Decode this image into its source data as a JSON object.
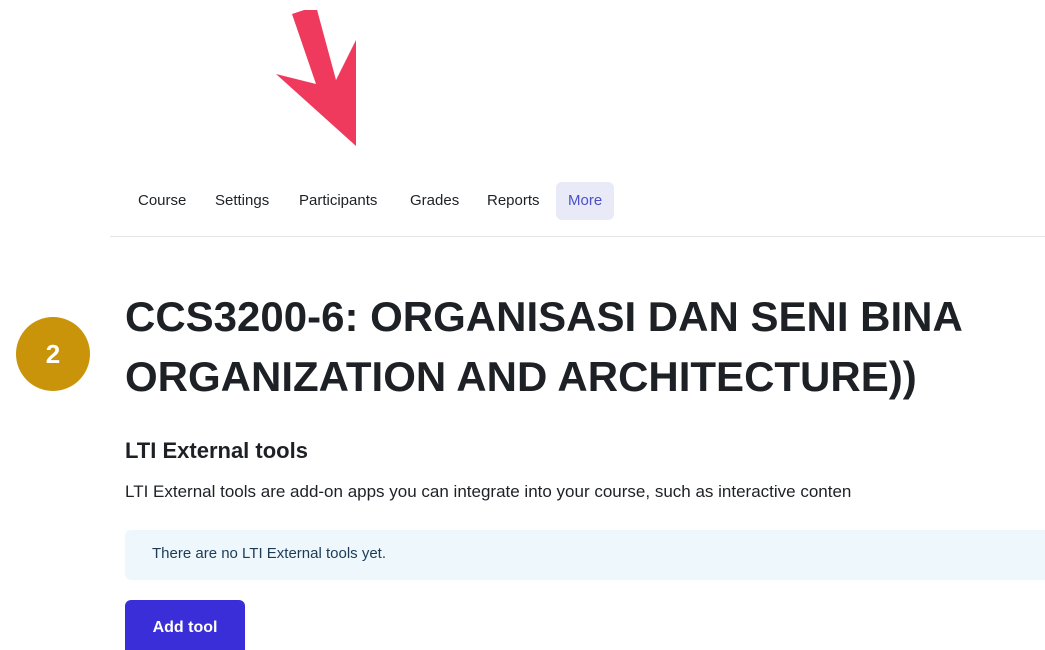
{
  "secondary_nav": {
    "items": [
      {
        "label": "Course"
      },
      {
        "label": "Settings"
      },
      {
        "label": "Participants"
      },
      {
        "label": "Grades"
      },
      {
        "label": "Reports"
      },
      {
        "label": "More",
        "active": true
      }
    ]
  },
  "step_badge": {
    "number": "2",
    "color": "#c9930a"
  },
  "arrow": {
    "icon": "arrow-down-right-icon",
    "color": "#ef3a5d"
  },
  "course": {
    "title_line1": "CCS3200-6: ORGANISASI DAN SENI BINA",
    "title_line2": "ORGANIZATION AND ARCHITECTURE))"
  },
  "lti_section": {
    "heading": "LTI External tools",
    "description": "LTI External tools are add-on apps you can integrate into your course, such as interactive conten",
    "empty_message": "There are no LTI External tools yet.",
    "add_button_label": "Add tool"
  },
  "colors": {
    "accent": "#3a2ed8",
    "active_tab_bg": "#e9eaf8",
    "active_tab_text": "#4b4fc9",
    "info_bg": "#eef7fb"
  }
}
